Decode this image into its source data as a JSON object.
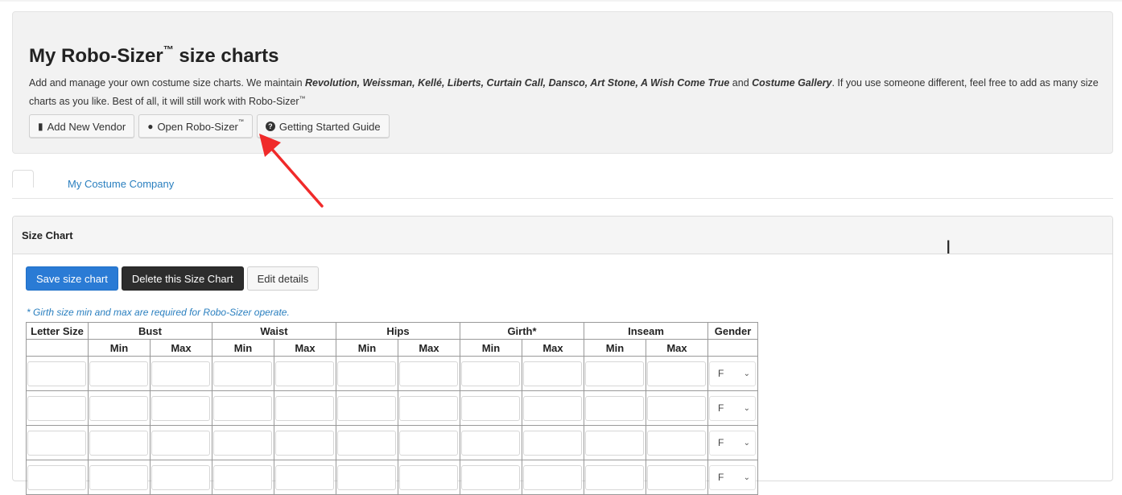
{
  "header": {
    "title": "My Robo-Sizer",
    "title_tm": "™",
    "title_suffix": " size charts",
    "intro": {
      "part1": "Add and manage your own costume size charts. We maintain ",
      "vendors": "Revolution, Weissman, Kellé, Liberts, Curtain Call, Dansco, Art Stone, A Wish Come True",
      "and": " and ",
      "gallery": "Costume Gallery",
      "part2": ". If you use someone different, feel free to add as many size charts as you like. Best of all, it will still work with Robo-Sizer",
      "tm": "™"
    },
    "buttons": {
      "add_vendor": "Add New Vendor",
      "open_robo": "Open Robo-Sizer",
      "open_robo_tm": "™",
      "guide": "Getting Started Guide"
    }
  },
  "tabs": {
    "vendor": "My Costume Company"
  },
  "panel": {
    "heading": "Size Chart",
    "actions": {
      "save": "Save  size chart",
      "delete": "Delete this Size Chart",
      "edit": "Edit details"
    },
    "note": "* Girth size min and max are required for Robo-Sizer operate.",
    "table": {
      "headers": {
        "letter": "Letter Size",
        "bust": "Bust",
        "waist": "Waist",
        "hips": "Hips",
        "girth": "Girth*",
        "inseam": "Inseam",
        "gender": "Gender"
      },
      "min": "Min",
      "max": "Max",
      "rows": [
        {
          "gender": "F"
        },
        {
          "gender": "F"
        },
        {
          "gender": "F"
        },
        {
          "gender": "F"
        }
      ]
    }
  },
  "colors": {
    "primary": "#2a7bd5",
    "dark": "#2d2d2d",
    "link": "#2a7fbf",
    "arrow": "#f02a2a"
  }
}
